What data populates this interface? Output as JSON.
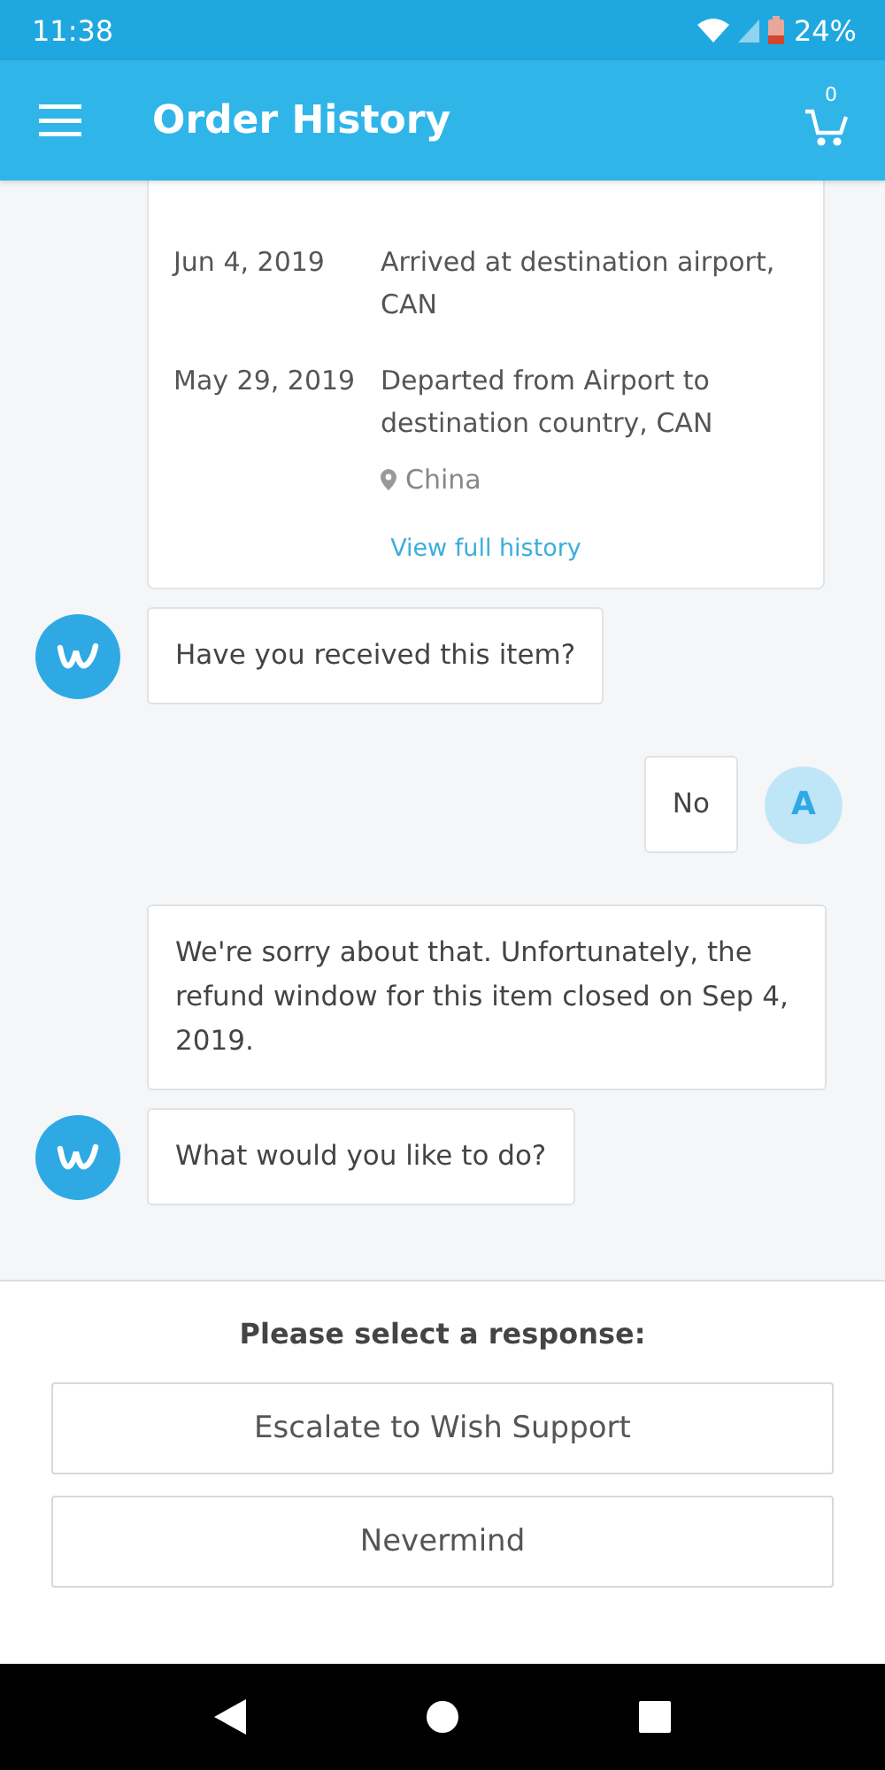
{
  "status_bar": {
    "time": "11:38",
    "battery": "24%"
  },
  "app_bar": {
    "title": "Order History",
    "cart_count": "0"
  },
  "tracking": {
    "events": [
      {
        "date": "Jun 4, 2019",
        "description": "Arrived at destination airport, CAN"
      },
      {
        "date": "May 29, 2019",
        "description": "Departed from Airport to destination country, CAN",
        "location": "China"
      }
    ],
    "link": "View full history"
  },
  "messages": [
    {
      "kind": "bot",
      "text": "Have you received this item?",
      "avatar": true
    },
    {
      "kind": "user",
      "text": "No",
      "avatar": true,
      "avatar_letter": "A"
    },
    {
      "kind": "bot",
      "text": "We're sorry about that. Unfortunately, the refund window for this item closed on Sep 4, 2019.",
      "avatar": false
    },
    {
      "kind": "bot",
      "text": "What would you like to do?",
      "avatar": true
    }
  ],
  "responses": {
    "prompt": "Please select a response:",
    "options": [
      "Escalate to Wish Support",
      "Nevermind"
    ]
  }
}
